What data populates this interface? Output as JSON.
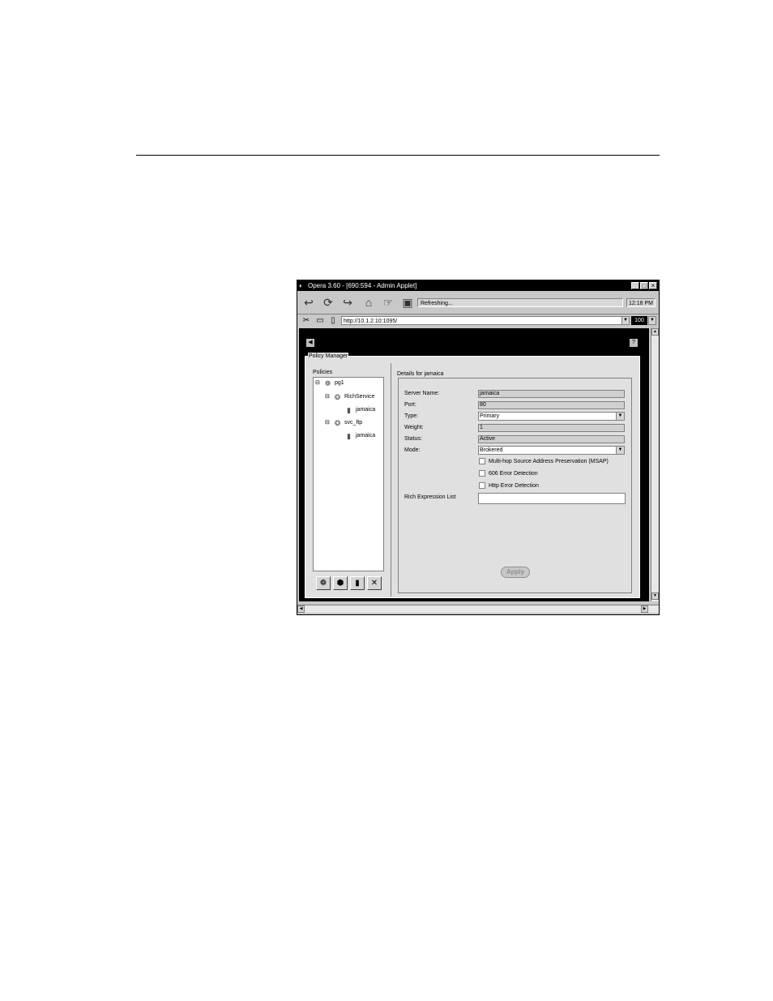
{
  "window": {
    "title": "Opera 3.60 - [690:594 - Admin Applet]",
    "minimize": "_",
    "maximize": "□",
    "close": "×"
  },
  "toolbar": {
    "status": "Refreshing...",
    "clock": "12:18 PM"
  },
  "address": {
    "url": "http://10.1.2.10:1095/",
    "zoom": "100"
  },
  "policy_manager": {
    "title": "Policy Manager",
    "policies_label": "Policies",
    "tree": [
      {
        "label": "pg1",
        "expander": "⊟",
        "icon": "group-icon"
      },
      {
        "label": "RichService",
        "expander": "⊟",
        "icon": "service-icon"
      },
      {
        "label": "jamaica",
        "icon": "server-icon"
      },
      {
        "label": "svc_ftp",
        "expander": "⊟",
        "icon": "service-icon"
      },
      {
        "label": "jamaica",
        "icon": "server-icon"
      }
    ],
    "buttons": {
      "remove": "✕"
    }
  },
  "details": {
    "title": "Details for jamaica",
    "fields": {
      "server_name": {
        "label": "Server Name:",
        "value": "jamaica"
      },
      "port": {
        "label": "Port:",
        "value": "80"
      },
      "type": {
        "label": "Type:",
        "value": "Primary"
      },
      "weight": {
        "label": "Weight:",
        "value": "1"
      },
      "status": {
        "label": "Status:",
        "value": "Active"
      },
      "mode": {
        "label": "Mode:",
        "value": "Brokered"
      }
    },
    "checkboxes": {
      "msap": "Multi-hop Source Address Preservation (MSAP)",
      "err606": "606 Error Detection",
      "http_err": "Http Error Detection"
    },
    "rich_label": "Rich Expression List",
    "apply": "Apply"
  }
}
